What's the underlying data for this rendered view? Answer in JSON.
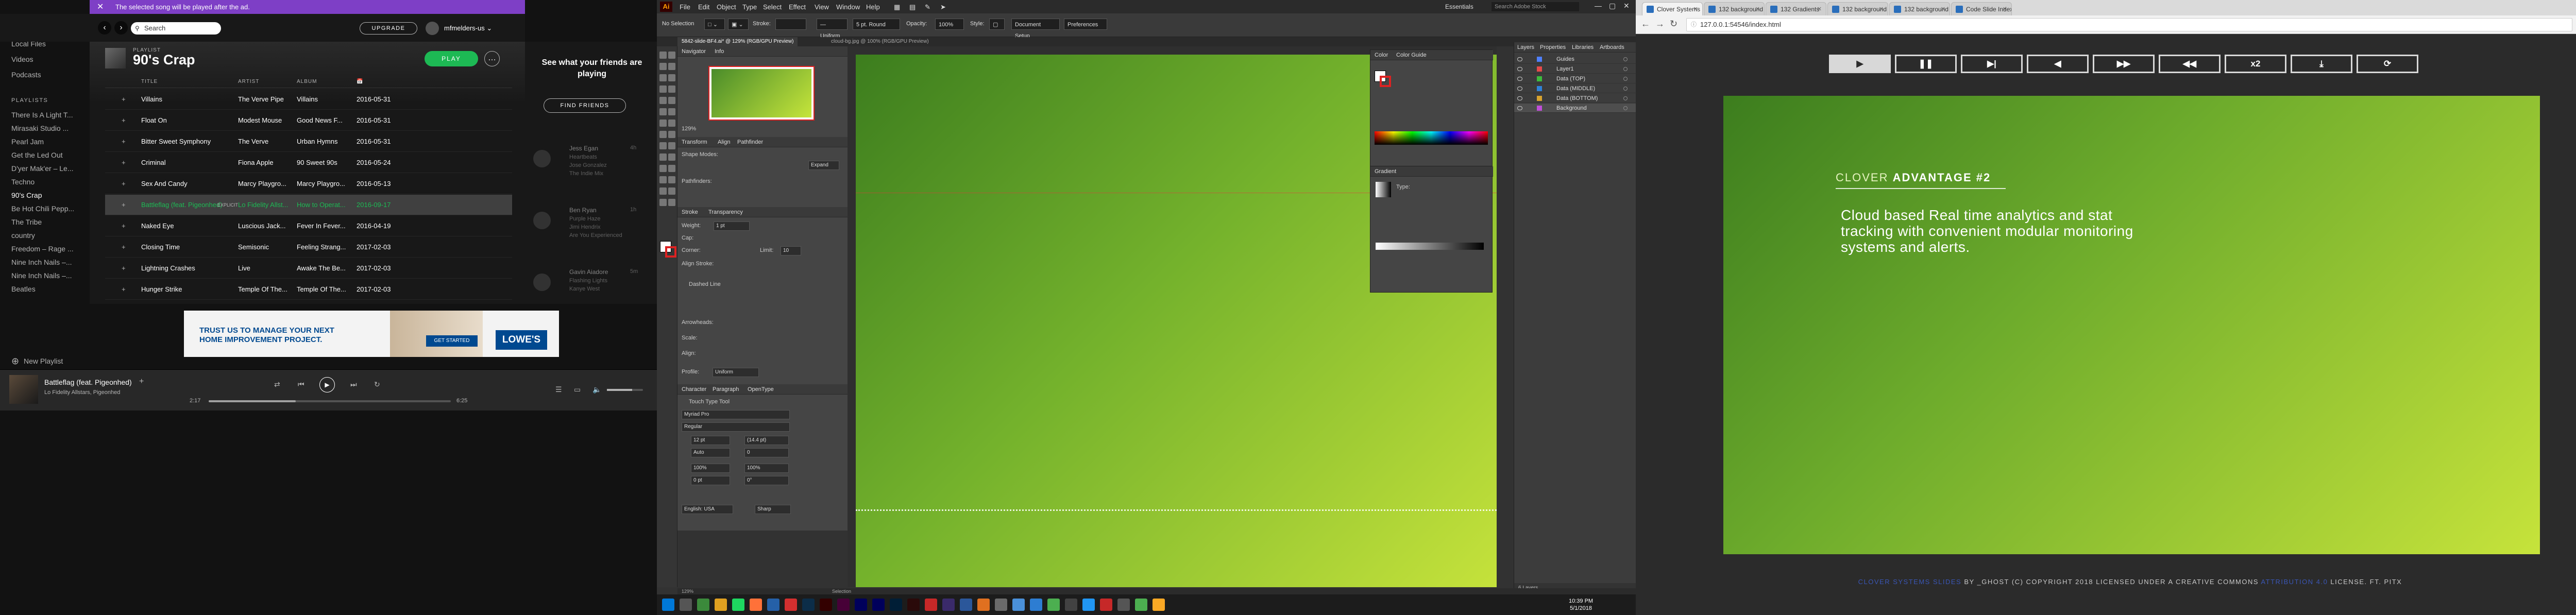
{
  "spotify": {
    "notice": "The selected song will be played after the ad.",
    "search_placeholder": "Search",
    "upgrade_label": "UPGRADE",
    "username": "mfmelders-us",
    "sidebar": {
      "items": [
        "Local Files",
        "Videos",
        "Podcasts"
      ],
      "section": "PLAYLISTS",
      "playlists": [
        "There Is A Light T...",
        "Mirasaki Studio ...",
        "Pearl Jam",
        "Get the Led Out",
        "D'yer Mak'er – Le...",
        "Techno",
        "90's Crap",
        "Be Hot Chili Pepp...",
        "The Tribe",
        "country",
        "Freedom – Rage ...",
        "Nine Inch Nails –...",
        "Nine Inch Nails –...",
        "Beatles"
      ],
      "active_playlist": "90's Crap",
      "new_playlist": "New Playlist"
    },
    "playlist": {
      "label": "PLAYLIST",
      "title": "90's Crap",
      "play_label": "PLAY",
      "more": "…"
    },
    "columns": [
      "TITLE",
      "ARTIST",
      "ALBUM",
      "📅"
    ],
    "tracks": [
      {
        "title": "Villains",
        "artist": "The Verve Pipe",
        "album": "Villains",
        "date": "2016-05-31"
      },
      {
        "title": "Float On",
        "artist": "Modest Mouse",
        "album": "Good News F...",
        "date": "2016-05-31"
      },
      {
        "title": "Bitter Sweet Symphony",
        "artist": "The Verve",
        "album": "Urban Hymns",
        "date": "2016-05-31"
      },
      {
        "title": "Criminal",
        "artist": "Fiona Apple",
        "album": "90 Sweet 90s",
        "date": "2016-05-24"
      },
      {
        "title": "Sex And Candy",
        "artist": "Marcy Playgro...",
        "album": "Marcy Playgro...",
        "date": "2016-05-13"
      },
      {
        "title": "Battleflag (feat. Pigeonhed)",
        "explicit": "EXPLICIT",
        "artist": "Lo Fidelity Allst...",
        "album": "How to Operat...",
        "date": "2016-09-17",
        "playing": true
      },
      {
        "title": "Naked Eye",
        "artist": "Luscious Jack...",
        "album": "Fever In Fever...",
        "date": "2016-04-19"
      },
      {
        "title": "Closing Time",
        "artist": "Semisonic",
        "album": "Feeling Strang...",
        "date": "2017-02-03"
      },
      {
        "title": "Lightning Crashes",
        "artist": "Live",
        "album": "Awake The Be...",
        "date": "2017-02-03"
      },
      {
        "title": "Hunger Strike",
        "artist": "Temple Of The...",
        "album": "Temple Of The...",
        "date": "2017-02-03"
      }
    ],
    "friends": {
      "title": "See what your friends are playing",
      "button": "FIND FRIENDS",
      "people": [
        {
          "name": "Jess Egan",
          "time": "4h",
          "line1": "Heartbeats",
          "line2": "Jose Gonzalez",
          "line3": "The Indie Mix"
        },
        {
          "name": "Ben Ryan",
          "time": "1h",
          "line1": "Purple Haze",
          "line2": "Jimi Hendrix",
          "line3": "Are You Experienced"
        },
        {
          "name": "Gavin Aiadore",
          "time": "5m",
          "line1": "Flashing Lights",
          "line2": "Kanye West",
          "line3": ""
        }
      ]
    },
    "ad": {
      "headline_1": "TRUST US TO MANAGE YOUR NEXT",
      "headline_2": "HOME IMPROVEMENT PROJECT.",
      "cta": "GET STARTED",
      "brand": "LOWE'S"
    },
    "now_playing": {
      "title": "Battleflag (feat. Pigeonhed)",
      "artist": "Lo Fidelity Allstars, Pigeonhed",
      "elapsed": "2:17",
      "total": "6:25",
      "progress": 0.36,
      "volume": 0.7
    }
  },
  "illustrator": {
    "menu": [
      "File",
      "Edit",
      "Object",
      "Type",
      "Select",
      "Effect",
      "View",
      "Window",
      "Help"
    ],
    "workspace": "Essentials",
    "search_placeholder": "Search Adobe Stock",
    "control": {
      "selection": "No Selection",
      "stroke_label": "Stroke:",
      "stroke_value": "",
      "brush": "5 pt. Round",
      "opacity_label": "Opacity:",
      "opacity_value": "100%",
      "style_label": "Style:",
      "doc_setup": "Document Setup",
      "preferences": "Preferences"
    },
    "tabs": [
      "5842-slide-BF4.ai* @ 129% (RGB/GPU Preview)",
      "cloud-bg.jpg @ 100% (RGB/GPU Preview)"
    ],
    "panels": {
      "navigator": "Navigator",
      "info": "Info",
      "zoom": "129%",
      "transform": "Transform",
      "align": "Align",
      "pathfinder": "Pathfinder",
      "shape_modes": "Shape Modes:",
      "pathfinders": "Pathfinders:",
      "expand": "Expand",
      "stroke": "Stroke",
      "transparency": "Transparency",
      "weight_label": "Weight:",
      "weight_value": "1 pt",
      "cap_label": "Cap:",
      "corner_label": "Corner:",
      "limit_label": "Limit:",
      "limit_value": "10",
      "align_stroke": "Align Stroke:",
      "dashed_line": "Dashed Line",
      "arrowheads": "Arrowheads:",
      "scale": "Scale:",
      "align_label": "Align:",
      "profile": "Profile:",
      "profile_value": "Uniform",
      "character": "Character",
      "paragraph": "Paragraph",
      "opentype": "OpenType",
      "touch_type": "Touch Type Tool",
      "font": "Myriad Pro",
      "font_style": "Regular",
      "size": "12 pt",
      "leading": "(14.4 pt)",
      "kerning": "Auto",
      "tracking": "0",
      "vscale": "100%",
      "hscale": "100%",
      "baseline": "0 pt",
      "rotation": "0°",
      "language": "English: USA",
      "sharp": "Sharp",
      "color": "Color",
      "color_guide": "Color Guide",
      "gradient": "Gradient",
      "type_label": "Type:"
    },
    "layers": {
      "tabs": [
        "Layers",
        "Properties",
        "Libraries",
        "Artboards"
      ],
      "items": [
        {
          "name": "Guides",
          "color": "#4f80ff"
        },
        {
          "name": "Layer1",
          "color": "#e64a4a"
        },
        {
          "name": "Data (TOP)",
          "color": "#3dbb3d"
        },
        {
          "name": "Data (MIDDLE)",
          "color": "#2f82d8"
        },
        {
          "name": "Data (BOTTOM)",
          "color": "#d8a32f"
        },
        {
          "name": "Background",
          "color": "#c04fd8",
          "selected": true
        }
      ],
      "count": "6 Layers"
    },
    "status": {
      "zoom": "129%",
      "tool": "Selection"
    },
    "clock": {
      "time": "10:39 PM",
      "date": "5/1/2018"
    }
  },
  "chrome": {
    "tabs": [
      {
        "title": "Clover Systems | AD",
        "active": true
      },
      {
        "title": "132 background slides"
      },
      {
        "title": "132 Gradients"
      },
      {
        "title": "132 background slides"
      },
      {
        "title": "132 background slides"
      },
      {
        "title": "Code Slide Index - ..."
      }
    ],
    "url": "127.0.0.1:54546/index.html",
    "buttons": [
      "▶",
      "❚❚",
      "▶|",
      "◀",
      "▶▶",
      "◀◀",
      "x2",
      "⤓",
      "⟳"
    ],
    "slide": {
      "heading_light": "CLOVER ",
      "heading_bold": "ADVANTAGE",
      "heading_num": " #2",
      "body": "Cloud based Real time analytics and stat tracking with convenient modular monitoring systems and alerts."
    },
    "footer": {
      "link1": "CLOVER SYSTEMS SLIDES",
      "mid": " BY _GHOST (C) COPYRIGHT 2018 LICENSED UNDER A CREATIVE COMMONS ",
      "link2": "ATTRIBUTION 4.0",
      "end": " LICENSE. FT. PITX"
    }
  },
  "colors": {
    "spotify_green": "#1db954",
    "notice_purple": "#7e3fc6",
    "slide_green_dark": "#3c7d1e",
    "slide_green_light": "#c6e33b",
    "illustrator_bg": "#323232"
  }
}
